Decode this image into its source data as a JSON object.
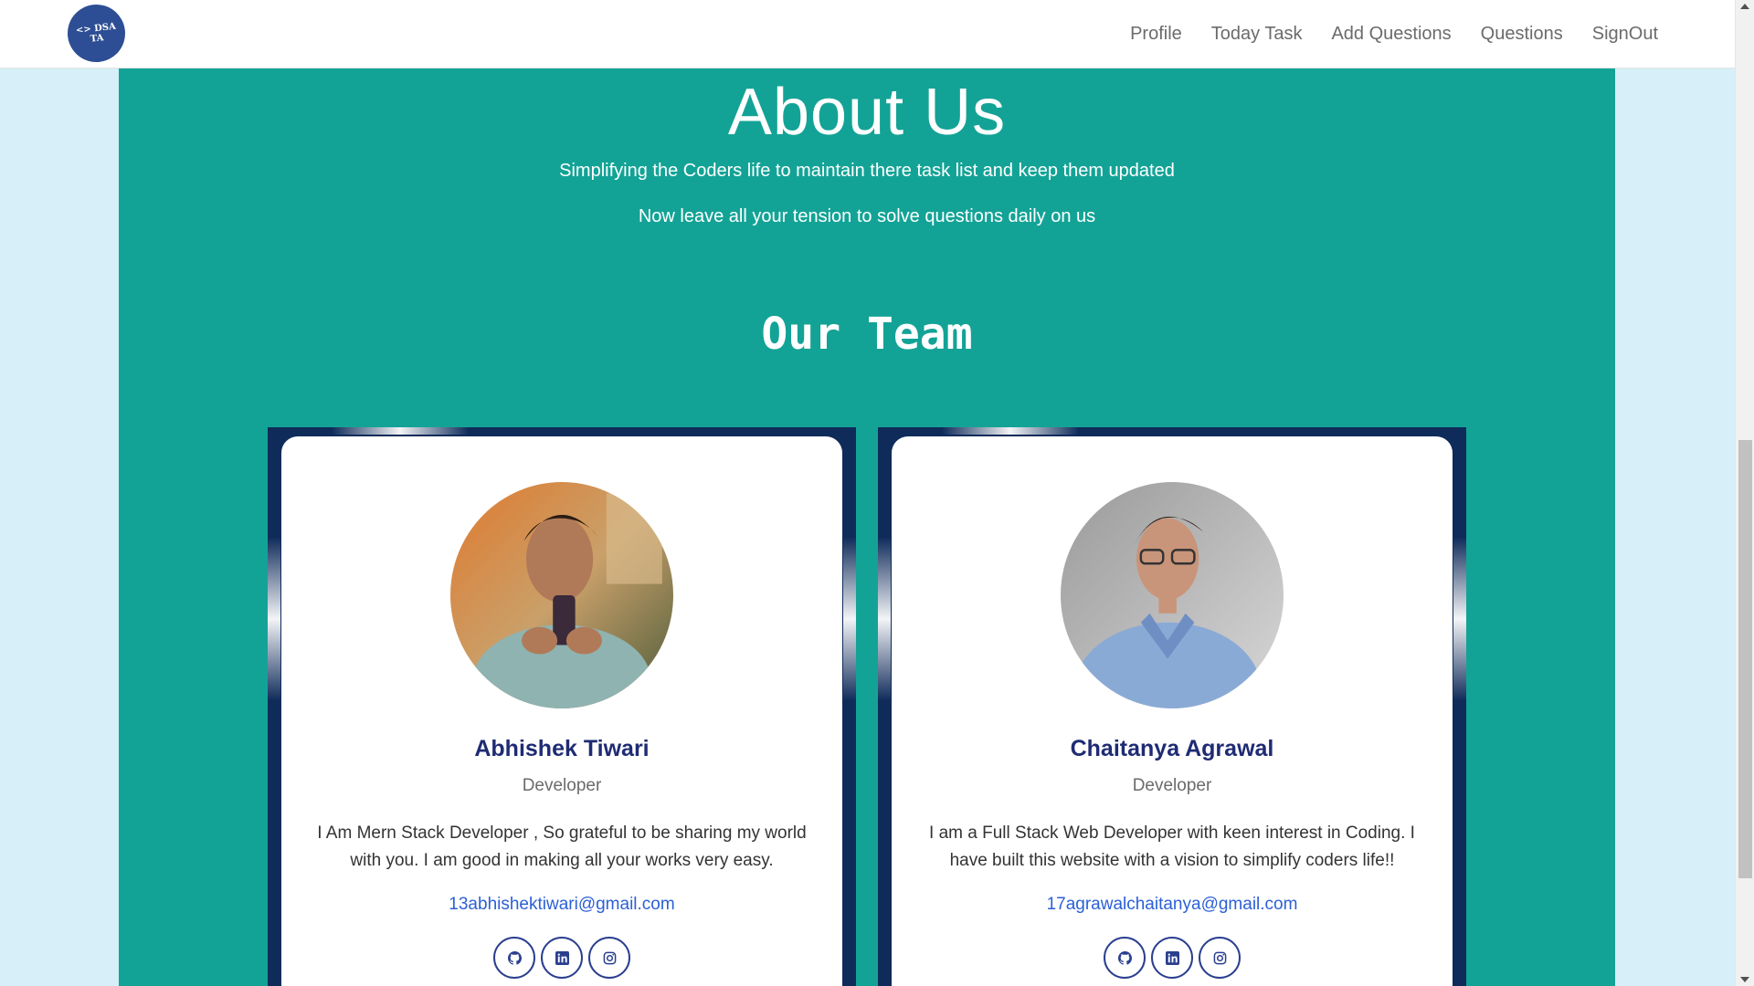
{
  "navbar": {
    "logo_line1": "<> DSA",
    "logo_line2": "TA",
    "links": [
      "Profile",
      "Today Task",
      "Add Questions",
      "Questions",
      "SignOut"
    ]
  },
  "about": {
    "title": "About Us",
    "line1": "Simplifying the Coders life to maintain there task list and keep them updated",
    "line2": "Now leave all your tension to solve questions daily on us"
  },
  "team": {
    "title": "Our Team",
    "members": [
      {
        "name": "Abhishek Tiwari",
        "role": "Developer",
        "bio": "I Am Mern Stack Developer , So grateful to be sharing my world with you. I am good in making all your works very easy.",
        "email": "13abhishektiwari@gmail.com",
        "socials": [
          "github-icon",
          "linkedin-icon",
          "instagram-icon"
        ]
      },
      {
        "name": "Chaitanya Agrawal",
        "role": "Developer",
        "bio": "I am a Full Stack Web Developer with keen interest in Coding. I have built this website with a vision to simplify coders life!!",
        "email": "17agrawalchaitanya@gmail.com",
        "socials": [
          "github-icon",
          "linkedin-icon",
          "instagram-icon"
        ]
      }
    ]
  },
  "colors": {
    "panel": "#13a396",
    "page_bg": "#d6eff8",
    "frame": "#0f2b5a",
    "name": "#1f2b73",
    "email": "#2c60d6",
    "logo": "#2d4e94"
  }
}
